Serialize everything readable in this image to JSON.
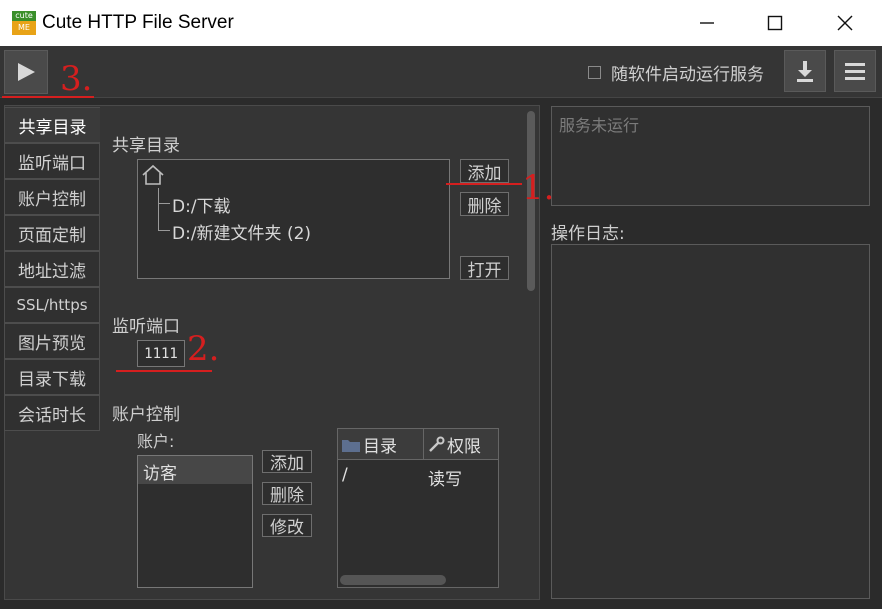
{
  "window": {
    "logo_top": "cute",
    "logo_bottom": "ME",
    "title": "Cute HTTP File Server",
    "minimize_glyph": "—",
    "maximize_glyph": "☐",
    "close_glyph": "✕"
  },
  "toolbar": {
    "start_icon": "play-icon",
    "autostart_label": "随软件启动运行服务",
    "autostart_checked": false,
    "download_icon": "download-icon",
    "menu_icon": "menu-icon"
  },
  "tabs": [
    {
      "label": "共享目录",
      "active": true
    },
    {
      "label": "监听端口"
    },
    {
      "label": "账户控制"
    },
    {
      "label": "页面定制"
    },
    {
      "label": "地址过滤"
    },
    {
      "label": "SSL/https"
    },
    {
      "label": "图片预览"
    },
    {
      "label": "目录下载"
    },
    {
      "label": "会话时长"
    }
  ],
  "shared": {
    "heading": "共享目录",
    "root_icon": "home-icon",
    "items": [
      "D:/下载",
      "D:/新建文件夹 (2)"
    ],
    "add_label": "添加",
    "delete_label": "删除",
    "open_label": "打开"
  },
  "port": {
    "heading": "监听端口",
    "value": "1111"
  },
  "accounts": {
    "heading": "账户控制",
    "sub_label": "账户:",
    "users": [
      "访客"
    ],
    "add_label": "添加",
    "delete_label": "删除",
    "edit_label": "修改",
    "perm_table": {
      "columns": [
        "目录",
        "权限"
      ],
      "rows": [
        [
          "/",
          "读写"
        ]
      ]
    }
  },
  "status": {
    "text": "服务未运行",
    "log_label": "操作日志:"
  },
  "annotations": {
    "one": "1.",
    "two": "2.",
    "three": "3.",
    "color": "#d51f1f"
  }
}
